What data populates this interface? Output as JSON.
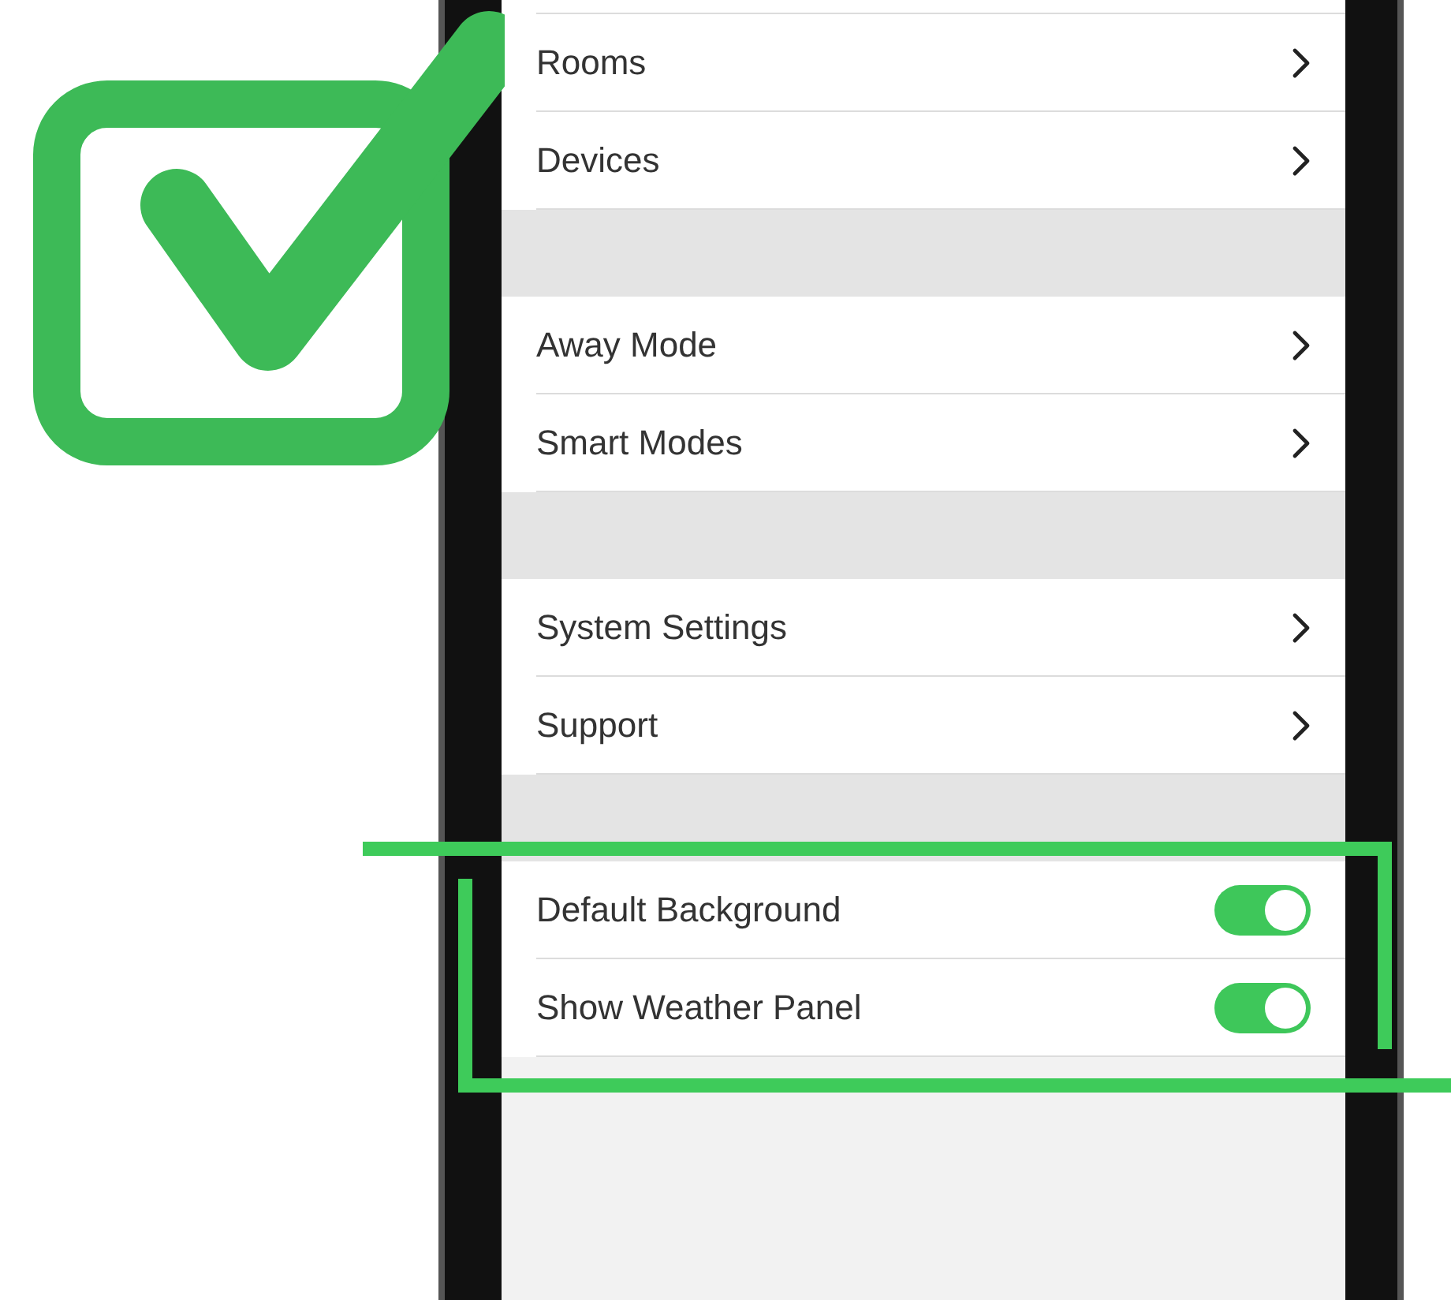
{
  "groups": [
    {
      "items": [
        {
          "kind": "link",
          "label": "Rooms"
        },
        {
          "kind": "link",
          "label": "Devices"
        }
      ]
    },
    {
      "items": [
        {
          "kind": "link",
          "label": "Away Mode"
        },
        {
          "kind": "link",
          "label": "Smart Modes"
        }
      ]
    },
    {
      "items": [
        {
          "kind": "link",
          "label": "System Settings"
        },
        {
          "kind": "link",
          "label": "Support"
        }
      ]
    },
    {
      "items": [
        {
          "kind": "toggle",
          "label": "Default Background",
          "on": true
        },
        {
          "kind": "toggle",
          "label": "Show Weather Panel",
          "on": true
        }
      ]
    }
  ]
}
